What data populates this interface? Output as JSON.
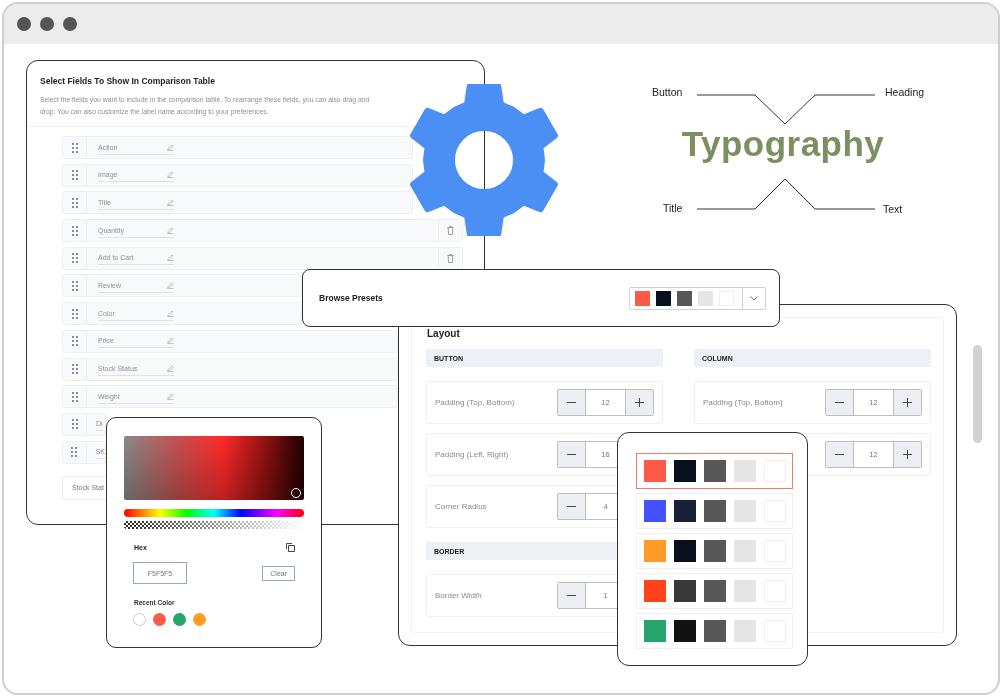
{
  "fields_panel": {
    "title": "Select Fields To Show In Comparison Table",
    "description": "Select the fields you want to include in the comparison table. To rearrange these fields, you can also drag and drop. You can also customize the label name according to your preferences.",
    "fields": [
      {
        "label": "Action",
        "removable": false
      },
      {
        "label": "Image",
        "removable": false
      },
      {
        "label": "Title",
        "removable": false
      },
      {
        "label": "Quantity",
        "removable": true
      },
      {
        "label": "Add to Cart",
        "removable": true
      },
      {
        "label": "Review",
        "removable": false
      },
      {
        "label": "Color",
        "removable": false
      },
      {
        "label": "Price",
        "removable": false
      },
      {
        "label": "Stock Status",
        "removable": false
      },
      {
        "label": "Weight",
        "removable": false
      },
      {
        "label": "Di",
        "removable": false
      },
      {
        "label": "SK",
        "removable": false
      }
    ],
    "footer_field": "Stock Stat"
  },
  "typography": {
    "title": "Typography",
    "labels": [
      "Button",
      "Heading",
      "Title",
      "Text"
    ]
  },
  "presets_bar": {
    "label": "Browse Presets",
    "swatches": [
      {
        "color": "#ff5a47"
      },
      {
        "color": "#0a0f1e"
      },
      {
        "color": "#575757"
      },
      {
        "color": "#e5e5e5"
      },
      {
        "color": "#ffffff"
      }
    ]
  },
  "layout_panel": {
    "title": "Layout",
    "left_sections": [
      {
        "heading": "BUTTON",
        "rows": [
          {
            "label": "Padding (Top, Bottom)",
            "value": "12"
          },
          {
            "label": "Padding (Left, Right)",
            "value": "16"
          },
          {
            "label": "Corner Radius",
            "value": "4"
          }
        ]
      },
      {
        "heading": "BORDER",
        "rows": [
          {
            "label": "Border Width",
            "value": "1"
          }
        ]
      }
    ],
    "right_sections": [
      {
        "heading": "COLUMN",
        "rows": [
          {
            "label": "Padding (Top, Bottom)",
            "value": "12"
          },
          {
            "value": "12"
          }
        ]
      }
    ]
  },
  "preset_popup": {
    "presets": [
      {
        "selected": true,
        "swatches": [
          {
            "color": "#ff5a47"
          },
          {
            "color": "#0a0f1e"
          },
          {
            "color": "#575757"
          },
          {
            "color": "#e5e5e5"
          },
          {
            "color": "#ffffff"
          }
        ]
      },
      {
        "selected": false,
        "swatches": [
          {
            "color": "#4451ff"
          },
          {
            "color": "#1a2038"
          },
          {
            "color": "#575757"
          },
          {
            "color": "#e5e5e5"
          },
          {
            "color": "#ffffff"
          }
        ]
      },
      {
        "selected": false,
        "swatches": [
          {
            "color": "#ff9b26"
          },
          {
            "color": "#0a0f1e"
          },
          {
            "color": "#575757"
          },
          {
            "color": "#e5e5e5"
          },
          {
            "color": "#ffffff"
          }
        ]
      },
      {
        "selected": false,
        "swatches": [
          {
            "color": "#ff421b"
          },
          {
            "color": "#383838"
          },
          {
            "color": "#575757"
          },
          {
            "color": "#e5e5e5"
          },
          {
            "color": "#ffffff"
          }
        ]
      },
      {
        "selected": false,
        "swatches": [
          {
            "color": "#25a56c"
          },
          {
            "color": "#121212"
          },
          {
            "color": "#575757"
          },
          {
            "color": "#e5e5e5"
          },
          {
            "color": "#ffffff"
          }
        ]
      }
    ]
  },
  "color_picker": {
    "hex_label": "Hex",
    "hex_value": "F5F5F5",
    "clear_button": "Clear",
    "recent_label": "Recent Color",
    "recent_colors": [
      {
        "color": "#ffffff"
      },
      {
        "color": "#ff5a47"
      },
      {
        "color": "#25a56c"
      },
      {
        "color": "#ff9b26"
      }
    ]
  }
}
